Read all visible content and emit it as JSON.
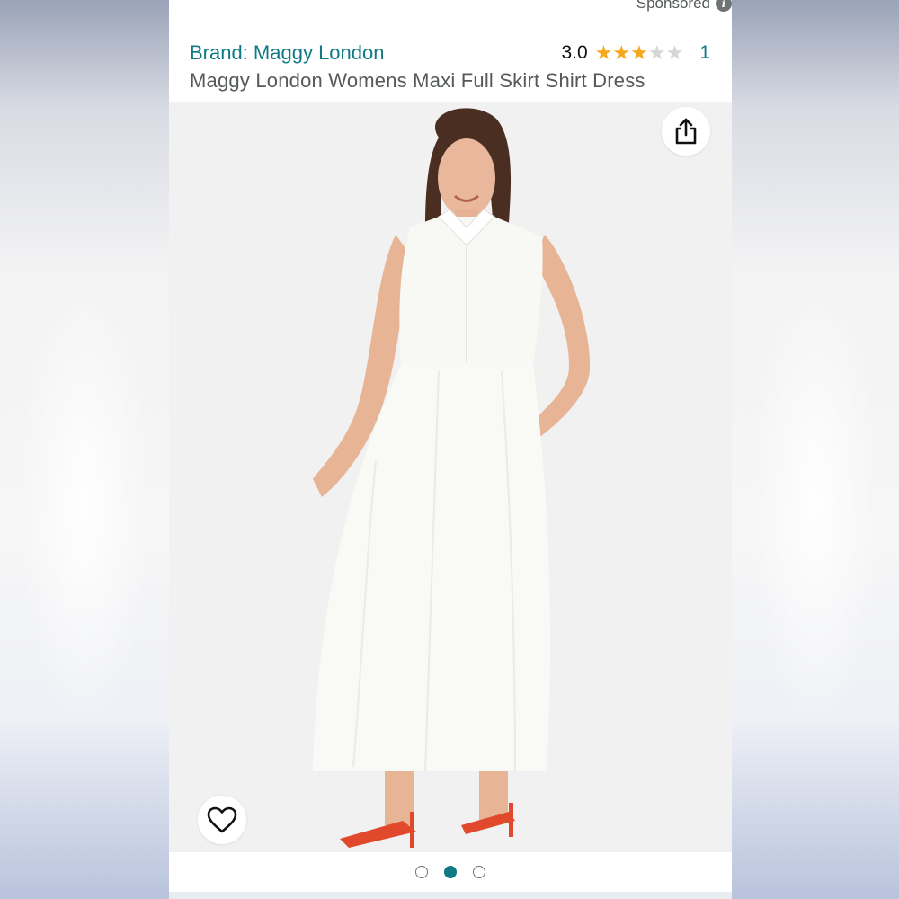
{
  "sponsored_label": "Sponsored",
  "sponsored_info_icon": "info-icon",
  "brand_link": "Brand: Maggy London",
  "rating": {
    "value": "3.0",
    "stars": 3,
    "max_stars": 5,
    "count": "1"
  },
  "product_title": "Maggy London Womens Maxi Full Skirt Shirt Dress",
  "image": {
    "share_icon": "share-icon",
    "wishlist_icon": "heart-icon",
    "description_icon": "product-photo"
  },
  "carousel": {
    "count": 3,
    "active_index": 1
  },
  "colors": {
    "link": "#0f7a85",
    "star": "#f6a81c",
    "text_secondary": "#565959"
  }
}
